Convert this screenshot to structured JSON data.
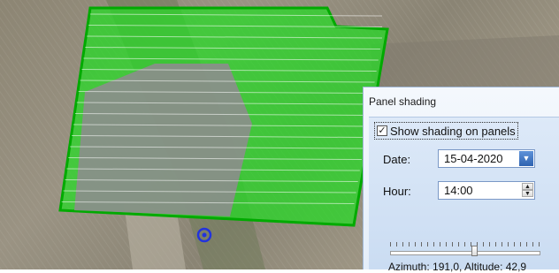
{
  "map": {
    "colors": {
      "array_fill": "#22dd22",
      "array_border": "#00aa00",
      "shade": "#8d8d8d",
      "marker": "#2233dd"
    },
    "marker_icon": "target-ring-icon"
  },
  "panel": {
    "title": "Panel shading",
    "show_shading": {
      "label": "Show shading on panels",
      "checked": true
    },
    "date": {
      "label": "Date:",
      "value": "15-04-2020",
      "button_icon": "dropdown-arrow-icon"
    },
    "hour": {
      "label": "Hour:",
      "value": "14:00",
      "button_icon": "spin-updown-icon"
    },
    "time_slider": {
      "level": 0.56
    },
    "status_text": "Azimuth: 191,0, Altitude: 42,9"
  }
}
